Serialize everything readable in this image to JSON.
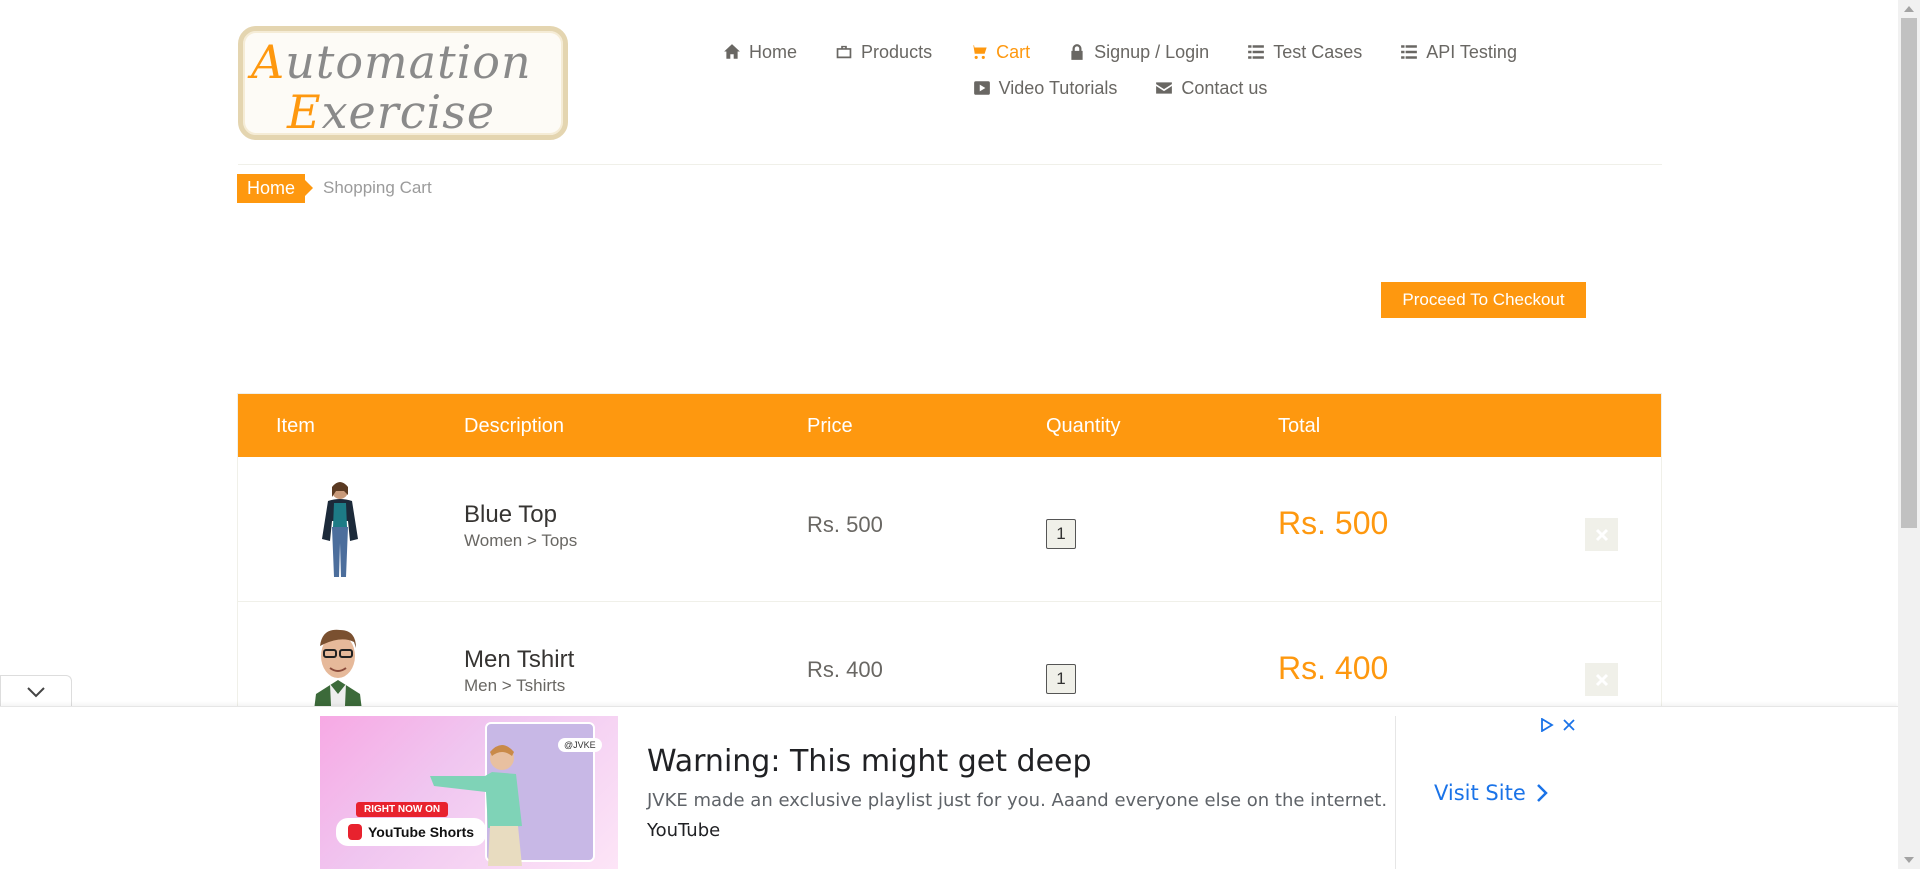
{
  "logo": {
    "line1_first": "A",
    "line1_rest": "utomation",
    "line2_first": "E",
    "line2_rest": "xercise"
  },
  "nav": {
    "items": [
      {
        "label": "Home",
        "icon": "home-icon"
      },
      {
        "label": "Products",
        "icon": "briefcase-icon"
      },
      {
        "label": "Cart",
        "icon": "shopping-cart-icon",
        "active": true
      },
      {
        "label": "Signup / Login",
        "icon": "lock-icon"
      },
      {
        "label": "Test Cases",
        "icon": "list-icon"
      },
      {
        "label": "API Testing",
        "icon": "list-icon"
      },
      {
        "label": "Video Tutorials",
        "icon": "youtube-play-icon"
      },
      {
        "label": "Contact us",
        "icon": "envelope-icon"
      }
    ]
  },
  "breadcrumb": {
    "home": "Home",
    "current": "Shopping Cart"
  },
  "checkout_label": "Proceed To Checkout",
  "cart": {
    "headers": {
      "item": "Item",
      "description": "Description",
      "price": "Price",
      "quantity": "Quantity",
      "total": "Total"
    },
    "rows": [
      {
        "name": "Blue Top",
        "category": "Women > Tops",
        "price": "Rs. 500",
        "quantity": "1",
        "total": "Rs. 500"
      },
      {
        "name": "Men Tshirt",
        "category": "Men > Tshirts",
        "price": "Rs. 400",
        "quantity": "1",
        "total": "Rs. 400"
      }
    ]
  },
  "ad": {
    "headline": "Warning: This might get deep",
    "description": "JVKE made an exclusive playlist just for you. Aaand everyone else on the internet.",
    "source": "YouTube",
    "visit_label": "Visit Site",
    "image_badge": "RIGHT NOW ON",
    "image_brand": "YouTube Shorts",
    "image_tag": "@JVKE"
  },
  "colors": {
    "accent": "#fe980f",
    "link_blue": "#1a73e8"
  }
}
